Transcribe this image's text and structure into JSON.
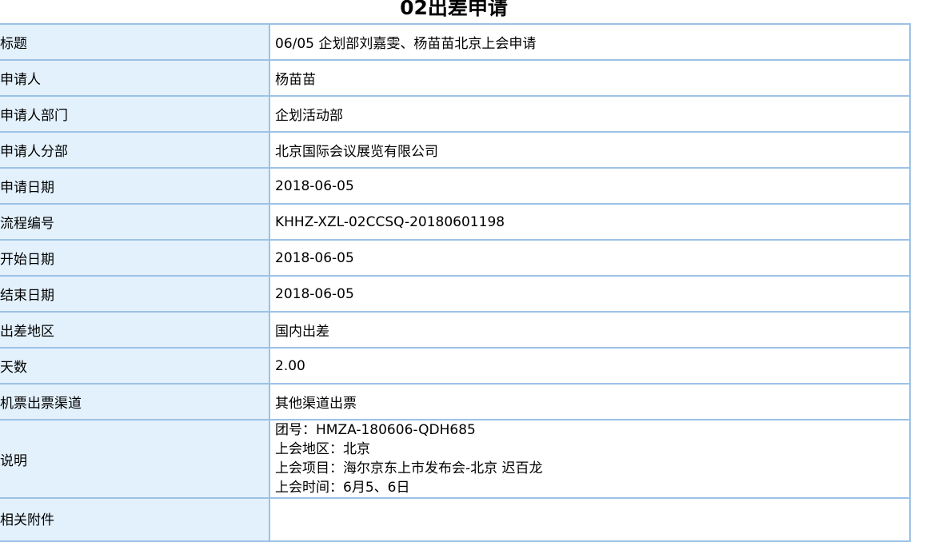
{
  "form": {
    "title": "02出差申请",
    "rows": [
      {
        "label": "标题",
        "value": "06/05 企划部刘嘉雯、杨苗苗北京上会申请"
      },
      {
        "label": "申请人",
        "value": "杨苗苗"
      },
      {
        "label": "申请人部门",
        "value": "企划活动部"
      },
      {
        "label": "申请人分部",
        "value": "北京国际会议展览有限公司"
      },
      {
        "label": "申请日期",
        "value": "2018-06-05"
      },
      {
        "label": "流程编号",
        "value": "KHHZ-XZL-02CCSQ-20180601198"
      },
      {
        "label": "开始日期",
        "value": "2018-06-05"
      },
      {
        "label": "结束日期",
        "value": "2018-06-05"
      },
      {
        "label": "出差地区",
        "value": "国内出差"
      },
      {
        "label": "天数",
        "value": "2.00"
      },
      {
        "label": "机票出票渠道",
        "value": "其他渠道出票"
      }
    ],
    "note": {
      "label": "说明",
      "lines": [
        "团号：HMZA-180606-QDH685",
        "上会地区：北京",
        "上会项目：海尔京东上市发布会-北京 迟百龙",
        "上会时间：6月5、6日"
      ]
    },
    "attachments": {
      "label": "相关附件",
      "value": ""
    }
  }
}
